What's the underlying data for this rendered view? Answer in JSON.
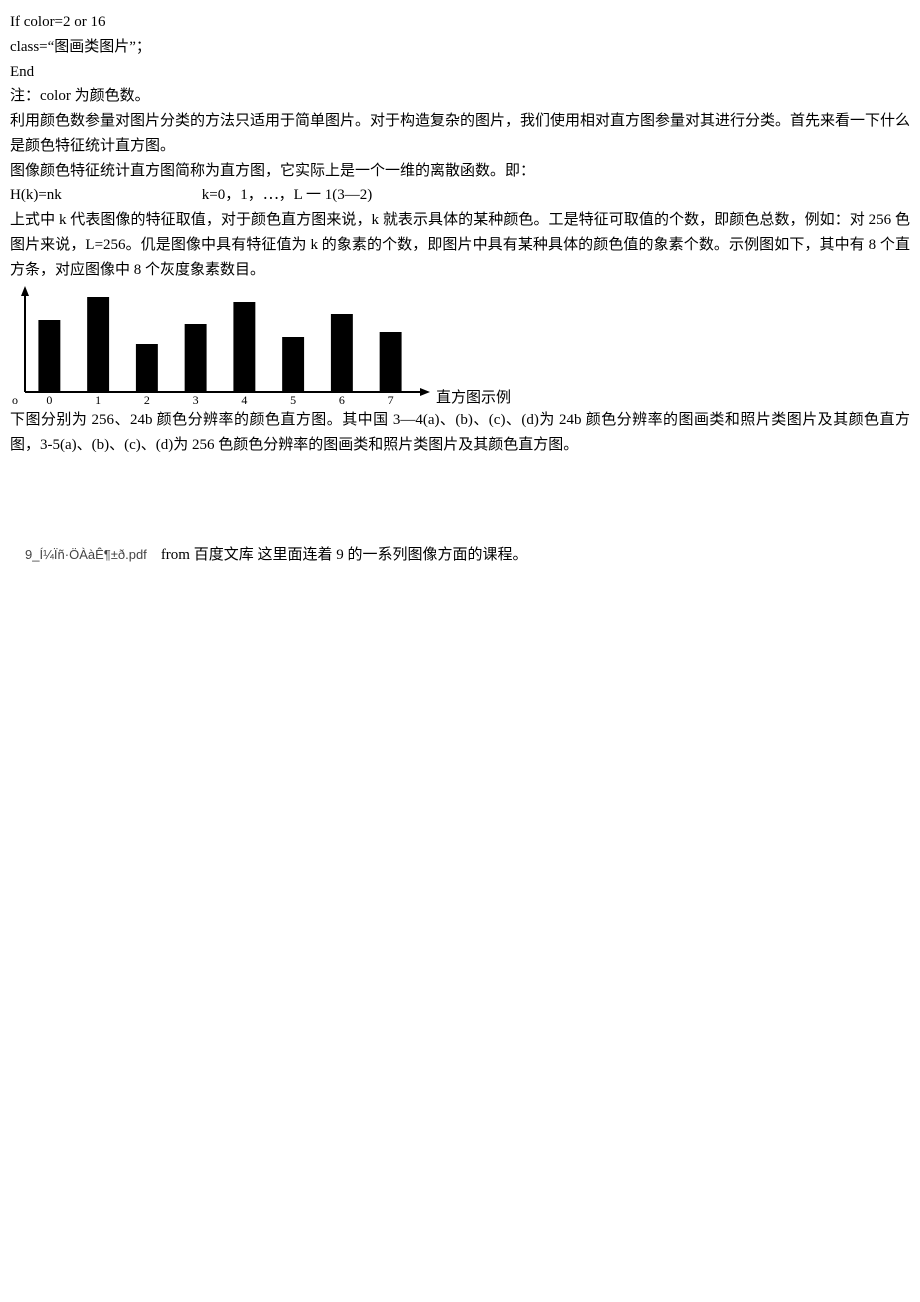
{
  "lines": {
    "l1": "If   color=2 or   16",
    "l2": "class=“图画类图片”；",
    "l3": "End",
    "l4": "注：color 为颜色数。",
    "l5": "利用颜色数参量对图片分类的方法只适用于简单图片。对于构造复杂的图片，我们使用相对直方图参量对其进行分类。首先来看一下什么是颜色特征统计直方图。",
    "l6": "图像颜色特征统计直方图简称为直方图，它实际上是一个一维的离散函数。即：",
    "l7a": "H(k)=nk",
    "l7b": "k=0，1，⋯，L 一 1(3—2)",
    "l8": "上式中 k 代表图像的特征取值，对于颜色直方图来说，k 就表示具体的某种颜色。工是特征可取值的个数，即颜色总数，例如：对 256 色图片来说，L=256。仉是图像中具有特征值为 k 的象素的个数，即图片中具有某种具体的颜色值的象素个数。示例图如下，其中有 8 个直方条，对应图像中 8 个灰度象素数目。",
    "chart_caption": "直方图示例",
    "l9": "下图分别为 256、24b 颜色分辨率的颜色直方图。其中国 3—4(a)、(b)、(c)、(d)为 24b 颜色分辨率的图画类和照片类图片及其颜色直方图，3-5(a)、(b)、(c)、(d)为 256 色颜色分辨率的图画类和照片类图片及其颜色直方图。"
  },
  "attachment": {
    "filename": "9_Í¼Ïñ·ÖÀàÊ¶±ð.pdf",
    "desc": "from  百度文库   这里面连着 9 的一系列图像方面的课程。"
  },
  "chart_data": {
    "type": "bar",
    "categories": [
      "0",
      "1",
      "2",
      "3",
      "4",
      "5",
      "6",
      "7"
    ],
    "values": [
      72,
      95,
      48,
      68,
      90,
      55,
      78,
      60
    ],
    "title": "直方图示例",
    "xlabel": "",
    "ylabel": "",
    "ylim": [
      0,
      100
    ]
  }
}
